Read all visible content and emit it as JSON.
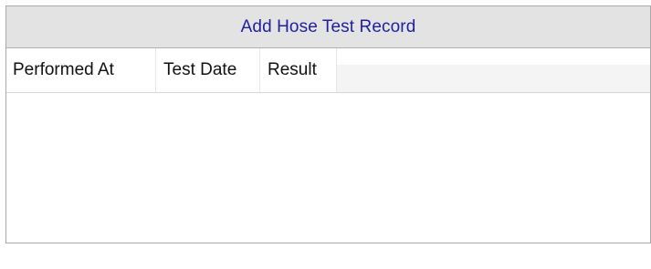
{
  "panel": {
    "title": "Add Hose Test Record"
  },
  "grid": {
    "columns": [
      "Performed At",
      "Test Date",
      "Result"
    ],
    "rows": []
  }
}
